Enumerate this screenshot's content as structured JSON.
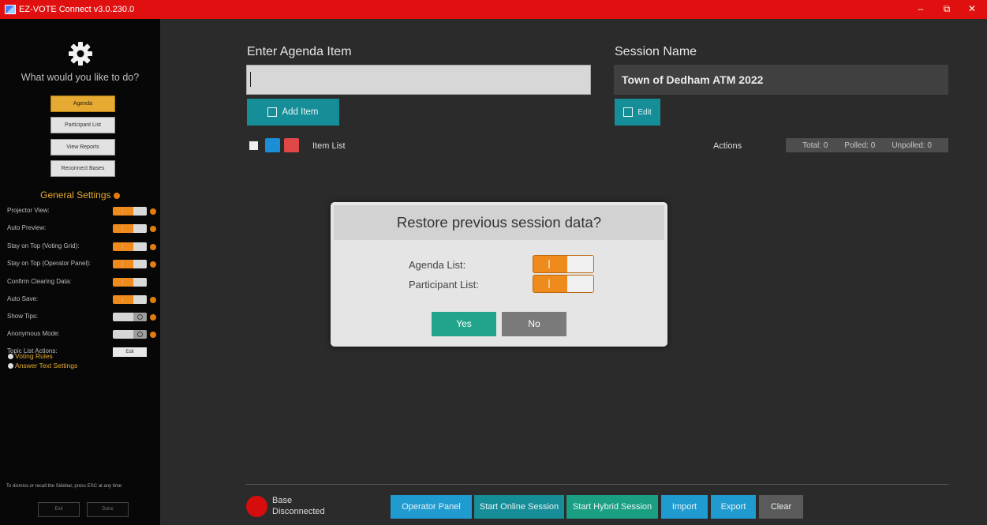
{
  "window": {
    "title": "EZ-VOTE Connect v3.0.230.0",
    "minimize": "–",
    "restore": "⧉",
    "close": "✕"
  },
  "sidebar": {
    "prompt": "What would you like to do?",
    "nav": [
      {
        "label": "Agenda",
        "active": true
      },
      {
        "label": "Participant List",
        "active": false
      },
      {
        "label": "View Reports",
        "active": false
      },
      {
        "label": "Reconnect Bases",
        "active": false
      }
    ],
    "general_settings_title": "General Settings",
    "settings": [
      {
        "label": "Projector View:",
        "state": "on"
      },
      {
        "label": "Auto Preview:",
        "state": "on"
      },
      {
        "label": "Stay on Top (Voting Grid):",
        "state": "on"
      },
      {
        "label": "Stay on Top (Operator Panel):",
        "state": "on"
      },
      {
        "label": "Confirm Clearing Data:",
        "state": "on"
      },
      {
        "label": "Auto Save:",
        "state": "on"
      },
      {
        "label": "Show Tips:",
        "state": "off"
      },
      {
        "label": "Anonymous Mode:",
        "state": "off"
      },
      {
        "label": "Topic List Actions:",
        "button": "Edit"
      }
    ],
    "links": [
      "Voting Rules",
      "Answer Text Settings"
    ],
    "hint": "To dismiss or recall the Sidebar, press ESC at any time",
    "footer": [
      "Exit",
      "Done"
    ]
  },
  "main": {
    "agenda_label": "Enter Agenda Item",
    "agenda_value": "",
    "add_item": "Add Item",
    "session_label": "Session Name",
    "session_value": "Town of Dedham ATM 2022",
    "edit": "Edit",
    "list_header": {
      "item_list": "Item List",
      "actions": "Actions",
      "total": "Total: 0",
      "polled": "Polled: 0",
      "unpolled": "Unpolled: 0"
    }
  },
  "dialog": {
    "title": "Restore previous session data?",
    "agenda_list": "Agenda List:",
    "participant_list": "Participant List:",
    "yes": "Yes",
    "no": "No"
  },
  "status": {
    "base_line1": "Base",
    "base_line2": "Disconnected",
    "led_color": "#d60d0d"
  },
  "bottom_buttons": [
    {
      "label": "Operator Panel",
      "color": "#1f9bd0"
    },
    {
      "label": "Start Online Session",
      "color": "#168e98"
    },
    {
      "label": "Start Hybrid Session",
      "color": "#1a9f83"
    },
    {
      "label": "Import",
      "color": "#1f9bd0"
    },
    {
      "label": "Export",
      "color": "#1f9bd0"
    },
    {
      "label": "Clear",
      "color": "#5a5a5a"
    }
  ]
}
